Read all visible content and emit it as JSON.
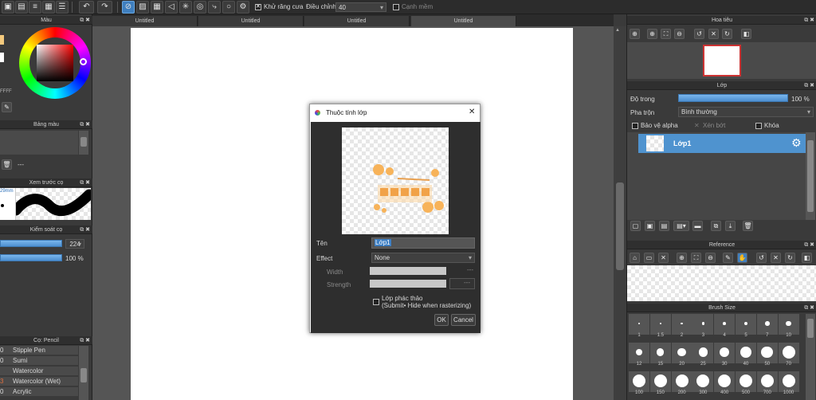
{
  "toolbar": {
    "antialias_label": "Khử răng cưa",
    "adjust_label": "Điều chỉnh",
    "adjust_value": "40",
    "edge_label": "Cạnh mềm"
  },
  "tabs": [
    "Untitled",
    "Untitled",
    "Untitled",
    "Untitled"
  ],
  "left": {
    "color_title": "Màu",
    "hex_value": "FFFF",
    "palette_title": "Bảng màu",
    "palette_dash": "---",
    "preview_title": "Xem trước cọ",
    "preview_size": "29mm",
    "brush_control_title": "Kiểm soát cọ",
    "size_value": "224",
    "opacity_value": "100 %",
    "brush_list_title": "Cọ: Pencil",
    "brushes": [
      {
        "num": "0",
        "name": "Stipple Pen"
      },
      {
        "num": "0",
        "name": "Sumi"
      },
      {
        "num": "",
        "name": "Watercolor"
      },
      {
        "num": "3",
        "name": "Watercolor (Wet)"
      },
      {
        "num": "0",
        "name": "Acrylic"
      }
    ]
  },
  "right": {
    "navigator_title": "Hoa tiêu",
    "layer_title": "Lớp",
    "opacity_label": "Độ trong",
    "opacity_value": "100 %",
    "blend_label": "Pha trộn",
    "blend_value": "Bình thường",
    "protect_alpha": "Bảo vệ alpha",
    "clipping": "Xén bớt",
    "lock": "Khóa",
    "layer_name": "Lớp1",
    "reference_title": "Reference",
    "brush_size_title": "Brush Size",
    "brush_sizes": [
      "1",
      "1.5",
      "2",
      "3",
      "4",
      "5",
      "7",
      "10",
      "12",
      "15",
      "20",
      "25",
      "30",
      "40",
      "50",
      "70",
      "100",
      "150",
      "200",
      "300",
      "400",
      "500",
      "700",
      "1000"
    ],
    "brush_size_diameters": [
      1,
      1,
      1.5,
      2,
      2.5,
      3,
      4,
      5,
      6,
      7,
      8,
      9,
      10,
      11,
      12,
      13,
      13,
      13,
      13,
      13,
      13,
      13,
      13,
      13
    ]
  },
  "dialog": {
    "title": "Thuộc tính lớp",
    "close": "✕",
    "name_label": "Tên",
    "name_value": "Lớp1",
    "effect_label": "Effect",
    "effect_value": "None",
    "width_label": "Width",
    "width_dash": "---",
    "strength_label": "Strength",
    "strength_dash": "---",
    "draft_line1": "Lớp phác thảo",
    "draft_line2": "(Submit• Hide when rasterizing)",
    "ok": "OK",
    "cancel": "Cancel"
  },
  "colors": {
    "accent": "#4f93cf",
    "panel": "#3a3a3a"
  }
}
